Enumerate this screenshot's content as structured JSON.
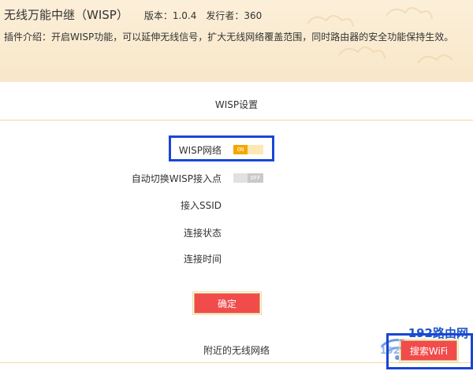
{
  "header": {
    "title": "无线万能中继（WISP）",
    "version": "版本：1.0.4",
    "publisher": "发行者：360",
    "description": "插件介绍：开启WISP功能，可以延伸无线信号，扩大无线网络覆盖范围，同时路由器的安全功能保持生效。"
  },
  "section": {
    "title": "WISP设置"
  },
  "form": {
    "wisp_network_label": "WISP网络",
    "wisp_network_state": "ON",
    "auto_switch_label": "自动切换WISP接入点",
    "auto_switch_state": "OFF",
    "ssid_label": "接入SSID",
    "status_label": "连接状态",
    "time_label": "连接时间"
  },
  "buttons": {
    "confirm": "确定",
    "search_wifi": "搜索WiFi"
  },
  "nearby": {
    "title": "附近的无线网络"
  },
  "watermark": {
    "text": "192路由网",
    "partial": "192"
  },
  "colors": {
    "accent": "#f5a700",
    "button": "#f24b4b",
    "highlight": "#1a46d6",
    "header_bg": "#fcefd9"
  }
}
